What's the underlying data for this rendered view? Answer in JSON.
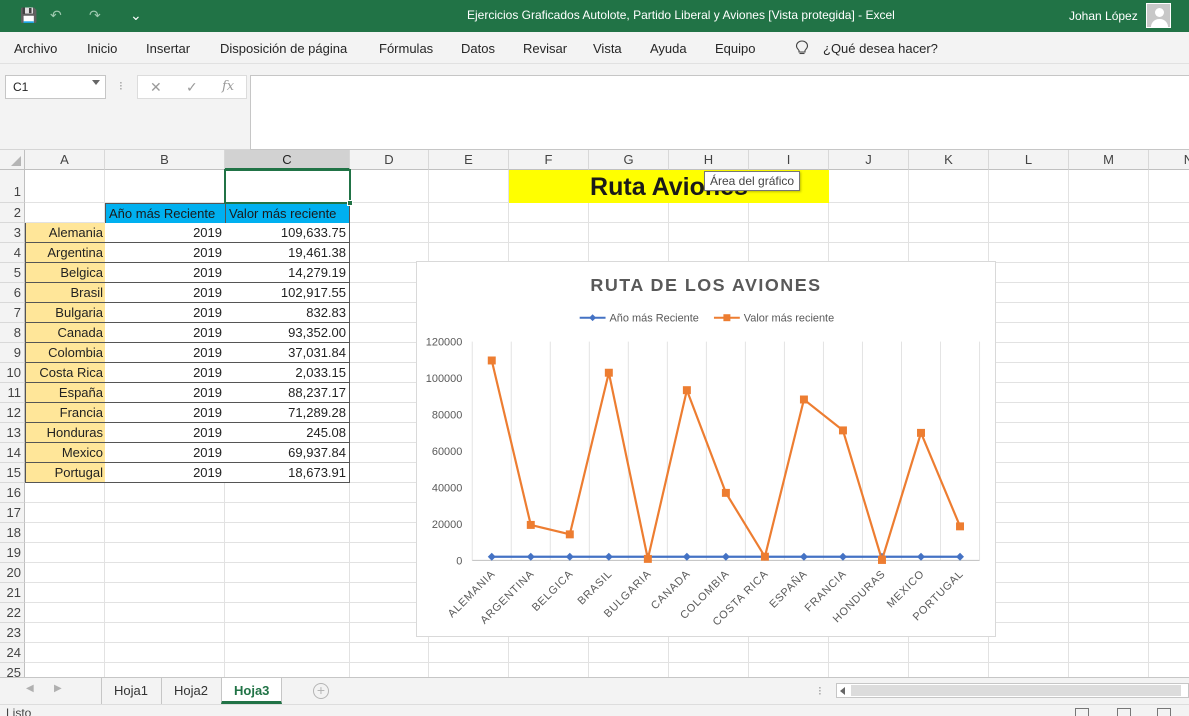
{
  "title_bar": {
    "title": "Ejercicios Graficados Autolote, Partido Liberal y Aviones  [Vista protegida]  -  Excel",
    "user": "Johan López",
    "quick_access": {
      "save": "💾",
      "undo": "↶",
      "redo": "↷",
      "more": "⌄"
    },
    "accent": "#217346"
  },
  "menu": {
    "tabs": [
      "Archivo",
      "Inicio",
      "Insertar",
      "Disposición de página",
      "Fórmulas",
      "Datos",
      "Revisar",
      "Vista",
      "Ayuda",
      "Equipo"
    ],
    "tell_me": "¿Qué desea hacer?"
  },
  "formula_bar": {
    "name_box": "C1",
    "cancel": "✕",
    "enter": "✓",
    "fx": "fx",
    "value": ""
  },
  "sheet": {
    "columns": [
      "A",
      "B",
      "C",
      "D",
      "E",
      "F",
      "G",
      "H",
      "I",
      "J",
      "K",
      "L",
      "M",
      "N"
    ],
    "rows": [
      "1",
      "2",
      "3",
      "4",
      "5",
      "6",
      "7",
      "8",
      "9",
      "10",
      "11",
      "12",
      "13",
      "14",
      "15",
      "16",
      "17",
      "18",
      "19",
      "20",
      "21",
      "22",
      "23",
      "24",
      "25"
    ],
    "selected_column": "C",
    "selected_cell": "C1",
    "header_year": "Año más Reciente",
    "header_value": "Valor más reciente",
    "banner": "Ruta Aviones",
    "data": [
      {
        "country": "Alemania",
        "year": "2019",
        "value": "109,633.75"
      },
      {
        "country": "Argentina",
        "year": "2019",
        "value": "19,461.38"
      },
      {
        "country": "Belgica",
        "year": "2019",
        "value": "14,279.19"
      },
      {
        "country": "Brasil",
        "year": "2019",
        "value": "102,917.55"
      },
      {
        "country": "Bulgaria",
        "year": "2019",
        "value": "832.83"
      },
      {
        "country": "Canada",
        "year": "2019",
        "value": "93,352.00"
      },
      {
        "country": "Colombia",
        "year": "2019",
        "value": "37,031.84"
      },
      {
        "country": "Costa Rica",
        "year": "2019",
        "value": "2,033.15"
      },
      {
        "country": "España",
        "year": "2019",
        "value": "88,237.17"
      },
      {
        "country": "Francia",
        "year": "2019",
        "value": "71,289.28"
      },
      {
        "country": "Honduras",
        "year": "2019",
        "value": "245.08"
      },
      {
        "country": "Mexico",
        "year": "2019",
        "value": "69,937.84"
      },
      {
        "country": "Portugal",
        "year": "2019",
        "value": "18,673.91"
      }
    ],
    "colors": {
      "country_fill": "#ffe699",
      "header_fill": "#00b0f0",
      "banner_fill": "#ffff00"
    }
  },
  "chart_data": {
    "type": "line",
    "title": "RUTA DE LOS AVIONES",
    "categories": [
      "ALEMANIA",
      "ARGENTINA",
      "BELGICA",
      "BRASIL",
      "BULGARIA",
      "CANADA",
      "COLOMBIA",
      "COSTA RICA",
      "ESPAÑA",
      "FRANCIA",
      "HONDURAS",
      "MEXICO",
      "PORTUGAL"
    ],
    "series": [
      {
        "name": "Año más Reciente",
        "color": "#4472c4",
        "marker": "diamond",
        "values": [
          2019,
          2019,
          2019,
          2019,
          2019,
          2019,
          2019,
          2019,
          2019,
          2019,
          2019,
          2019,
          2019
        ]
      },
      {
        "name": "Valor más reciente",
        "color": "#ed7d31",
        "marker": "square",
        "values": [
          109633.75,
          19461.38,
          14279.19,
          102917.55,
          832.83,
          93352.0,
          37031.84,
          2033.15,
          88237.17,
          71289.28,
          245.08,
          69937.84,
          18673.91
        ]
      }
    ],
    "yticks": [
      0,
      20000,
      40000,
      60000,
      80000,
      100000,
      120000
    ],
    "ylim": [
      0,
      120000
    ],
    "grid": "vertical",
    "legend": "top",
    "tooltip": "Área del gráfico"
  },
  "sheet_tabs": {
    "tabs": [
      "Hoja1",
      "Hoja2",
      "Hoja3"
    ],
    "active": "Hoja3"
  },
  "status": {
    "text": "Listo"
  }
}
